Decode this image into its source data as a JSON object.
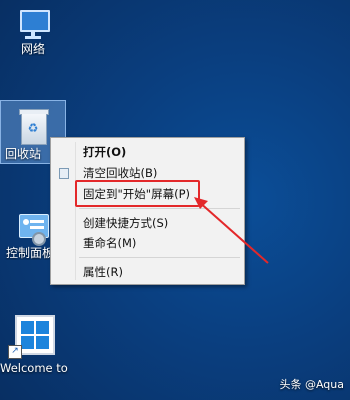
{
  "desktop": {
    "icons": [
      {
        "label": "网络",
        "icon": "network-icon"
      },
      {
        "label": "回收站",
        "icon": "recycle-bin-icon"
      },
      {
        "label": "控制面板",
        "icon": "control-panel-icon"
      },
      {
        "label": "Welcome to Tech Previ...",
        "icon": "windows-logo-icon"
      }
    ]
  },
  "context_menu": {
    "items": [
      {
        "label": "打开(O)",
        "bold": true
      },
      {
        "label": "清空回收站(B)",
        "icon": "recycle-bin-icon"
      },
      {
        "label": "固定到\"开始\"屏幕(P)",
        "highlighted": true
      },
      {
        "label": "创建快捷方式(S)"
      },
      {
        "label": "重命名(M)"
      },
      {
        "label": "属性(R)"
      }
    ]
  },
  "annotation": {
    "highlight_color": "#e3282a"
  },
  "watermark": "头条 @Aqua"
}
